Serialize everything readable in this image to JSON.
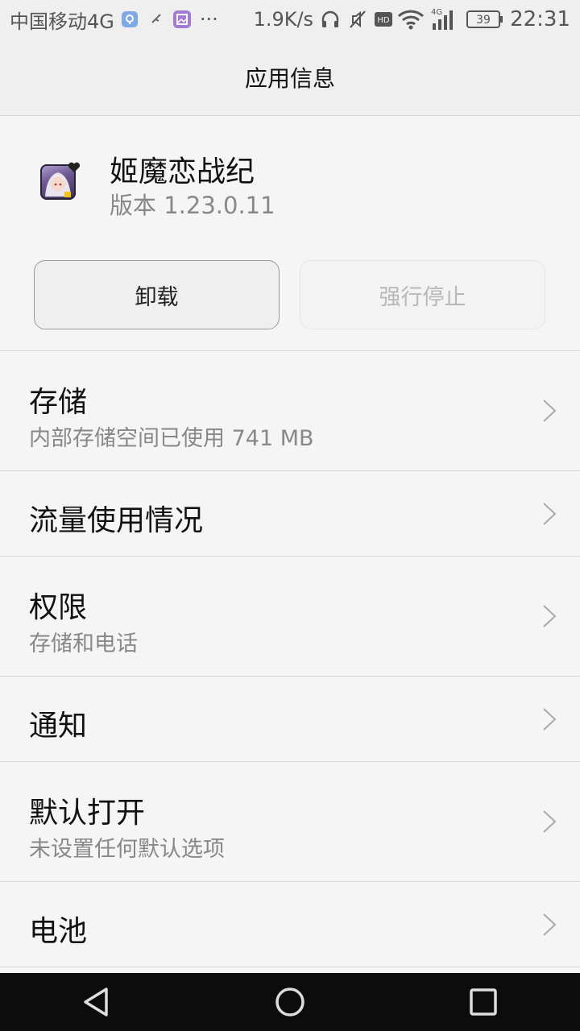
{
  "status_bar": {
    "carrier": "中国移动4G",
    "more": "···",
    "speed": "1.9K/s",
    "hd_label": "HD",
    "network_label": "4G",
    "battery": "39",
    "time": "22:31"
  },
  "header": {
    "title": "应用信息"
  },
  "app": {
    "name": "姬魔恋战纪",
    "version": "版本 1.23.0.11"
  },
  "buttons": {
    "uninstall": "卸载",
    "force_stop": "强行停止"
  },
  "list": {
    "items": [
      {
        "title": "存储",
        "subtitle": "内部存储空间已使用 741 MB"
      },
      {
        "title": "流量使用情况"
      },
      {
        "title": "权限",
        "subtitle": "存储和电话"
      },
      {
        "title": "通知"
      },
      {
        "title": "默认打开",
        "subtitle": "未设置任何默认选项"
      },
      {
        "title": "电池"
      }
    ]
  },
  "colors": {
    "background": "#f5f5f5",
    "header_bg": "#efefef",
    "text_primary": "#111111",
    "text_secondary": "#888888",
    "disabled_text": "#b8b8b8",
    "nav_bg": "#0c0c0c"
  }
}
